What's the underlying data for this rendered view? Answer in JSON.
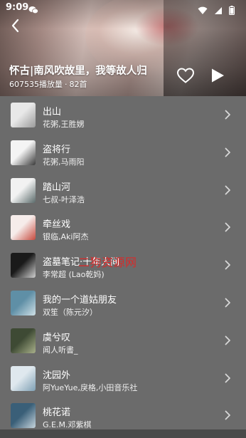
{
  "status": {
    "time": "9:09",
    "icons": [
      "wechat-icon",
      "wifi-icon",
      "signal-icon",
      "battery-icon"
    ]
  },
  "header": {
    "title": "怀古|南风吹故里，我等故人归",
    "play_count": "607535播放量",
    "separator": "·",
    "song_count": "82首",
    "icons": [
      "back-arrow-icon",
      "heart-icon",
      "play-icon"
    ]
  },
  "songs": [
    {
      "title": "出山",
      "artist": "花粥,王胜娚",
      "cover_colors": [
        "#e8e8e8",
        "#9a9a9a"
      ]
    },
    {
      "title": "盗将行",
      "artist": "花粥,马雨阳",
      "cover_colors": [
        "#f4f4f4",
        "#3a3a3a"
      ]
    },
    {
      "title": "踏山河",
      "artist": "七叔-叶泽浩",
      "cover_colors": [
        "#f2f2f2",
        "#5a6a6a"
      ]
    },
    {
      "title": "牵丝戏",
      "artist": "银临,Aki阿杰",
      "cover_colors": [
        "#f6ecea",
        "#c64a3e"
      ]
    },
    {
      "title": "盗墓笔记·十年人间",
      "artist": "李常超 (Lao乾妈)",
      "cover_colors": [
        "#1a1a1a",
        "#d0d0d0"
      ]
    },
    {
      "title": "我的一个道姑朋友",
      "artist": "双笙（陈元汐）",
      "cover_colors": [
        "#5f8fa6",
        "#cfe0e6"
      ]
    },
    {
      "title": "虞兮叹",
      "artist": "闻人听書_",
      "cover_colors": [
        "#3e4a34",
        "#a8b08a"
      ]
    },
    {
      "title": "沈园外",
      "artist": "阿YueYue,戾格,小田音乐社",
      "cover_colors": [
        "#dfe8ee",
        "#7fa0b4"
      ]
    },
    {
      "title": "桃花诺",
      "artist": "G.E.M.邓紫棋",
      "cover_colors": [
        "#3a5f78",
        "#c6d4dc"
      ]
    }
  ],
  "watermark": "二狗资源网",
  "colors": {
    "list_background": "#6b6b6b",
    "text": "#ffffff",
    "watermark": "#d82a2a"
  }
}
